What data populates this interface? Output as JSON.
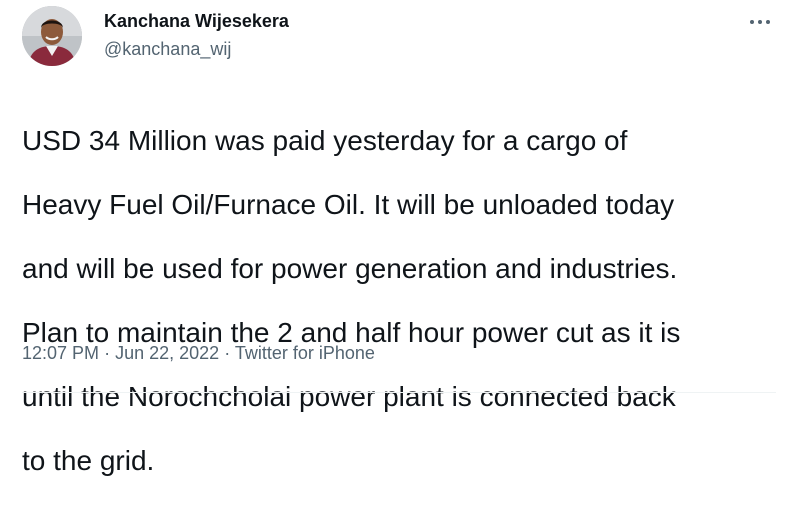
{
  "tweet": {
    "author": {
      "display_name": "Kanchana Wijesekera",
      "handle": "@kanchana_wij",
      "avatar_icon": "user-avatar-photo"
    },
    "more_icon": "more-options-icon",
    "text_lines": [
      "USD 34 Million was paid yesterday for a cargo of",
      "Heavy Fuel Oil/Furnace Oil. It will be unloaded today",
      "and will be used for power generation and industries.",
      "Plan to maintain the 2 and half hour power cut as it is",
      "until the Norochcholai power plant is connected back",
      "to the grid."
    ],
    "meta": {
      "time": "12:07 PM",
      "separator": "·",
      "date": "Jun 22, 2022",
      "source": "Twitter for iPhone"
    }
  },
  "colors": {
    "text_primary": "#0f1419",
    "text_secondary": "#536471",
    "divider": "#eff3f4"
  }
}
